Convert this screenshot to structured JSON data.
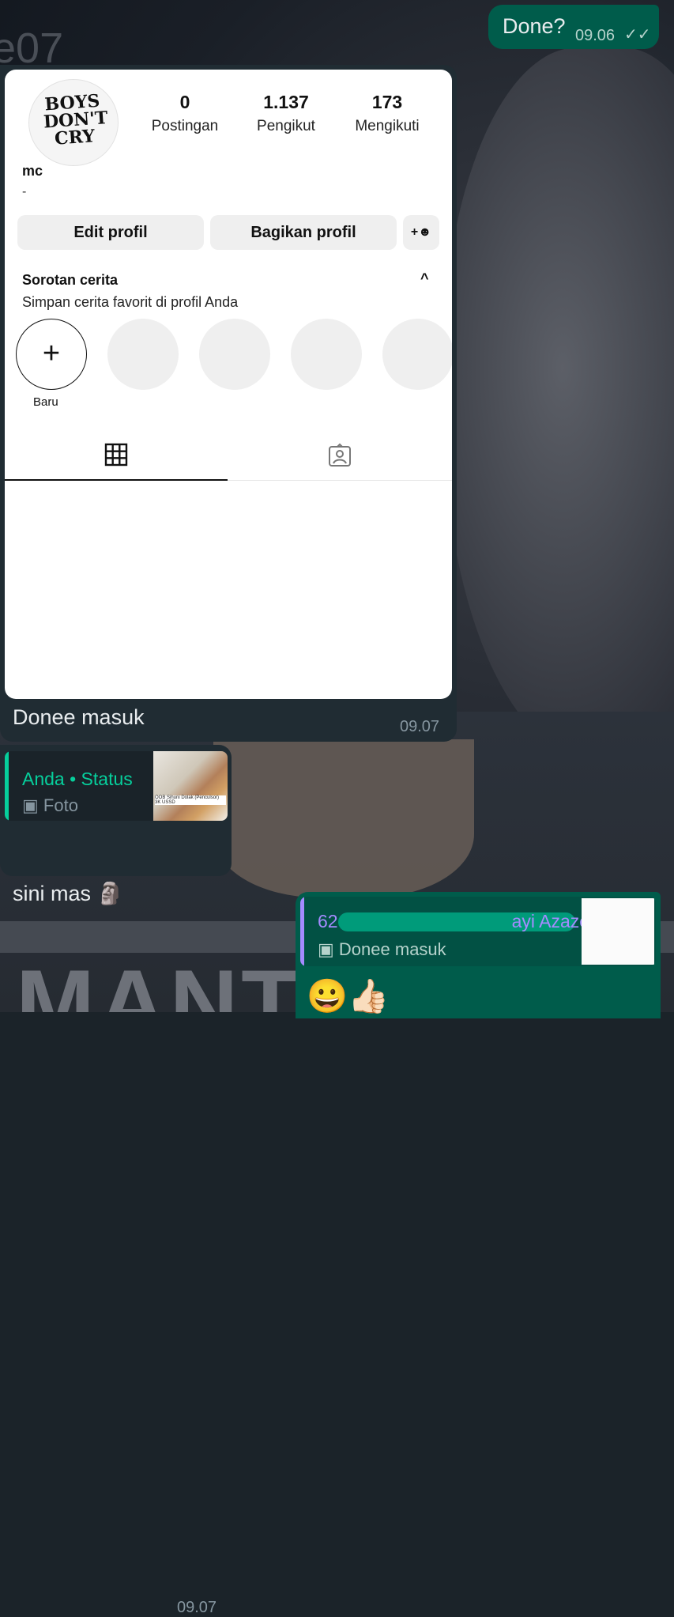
{
  "wallpaper": {
    "top_left_text": "e07",
    "bottom_text": "MANT"
  },
  "messages": {
    "top_outgoing": {
      "text": "Done?",
      "time": "09.06",
      "status_icon": "double-check-icon"
    },
    "image_message": {
      "caption": "Donee masuk",
      "time": "09.07",
      "instagram": {
        "avatar_text": "BOYS DON'T CRY",
        "stats": [
          {
            "value": "0",
            "label": "Postingan"
          },
          {
            "value": "1.137",
            "label": "Pengikut"
          },
          {
            "value": "173",
            "label": "Mengikuti"
          }
        ],
        "username": "mc",
        "bio": "-",
        "buttons": {
          "edit": "Edit profil",
          "share": "Bagikan profil",
          "add_person_icon": "add-person-icon"
        },
        "highlights": {
          "title": "Sorotan cerita",
          "subtitle": "Simpan cerita favorit di profil Anda",
          "new_label": "Baru",
          "collapse_icon": "chevron-up-icon"
        },
        "tabs": [
          {
            "icon": "grid-icon",
            "active": true
          },
          {
            "icon": "tagged-icon",
            "active": false
          }
        ]
      }
    },
    "reply_incoming": {
      "quote_author": "Anda • Status",
      "quote_type": "Foto",
      "quote_thumb_caption": "OOB Sihuni Dolak (Penculsor) 3K USSD",
      "text": "sini mas 🗿",
      "time": "09.07"
    },
    "reply_outgoing": {
      "quote_author_start": "62",
      "quote_author_end": "ayi Azazel",
      "quote_type": "Donee masuk",
      "text": "😀👍🏻"
    }
  },
  "colors": {
    "incoming_bubble": "#202c33",
    "outgoing_bubble": "#005c4b",
    "accent_green": "#06cf9c",
    "accent_purple": "#a58bff"
  }
}
